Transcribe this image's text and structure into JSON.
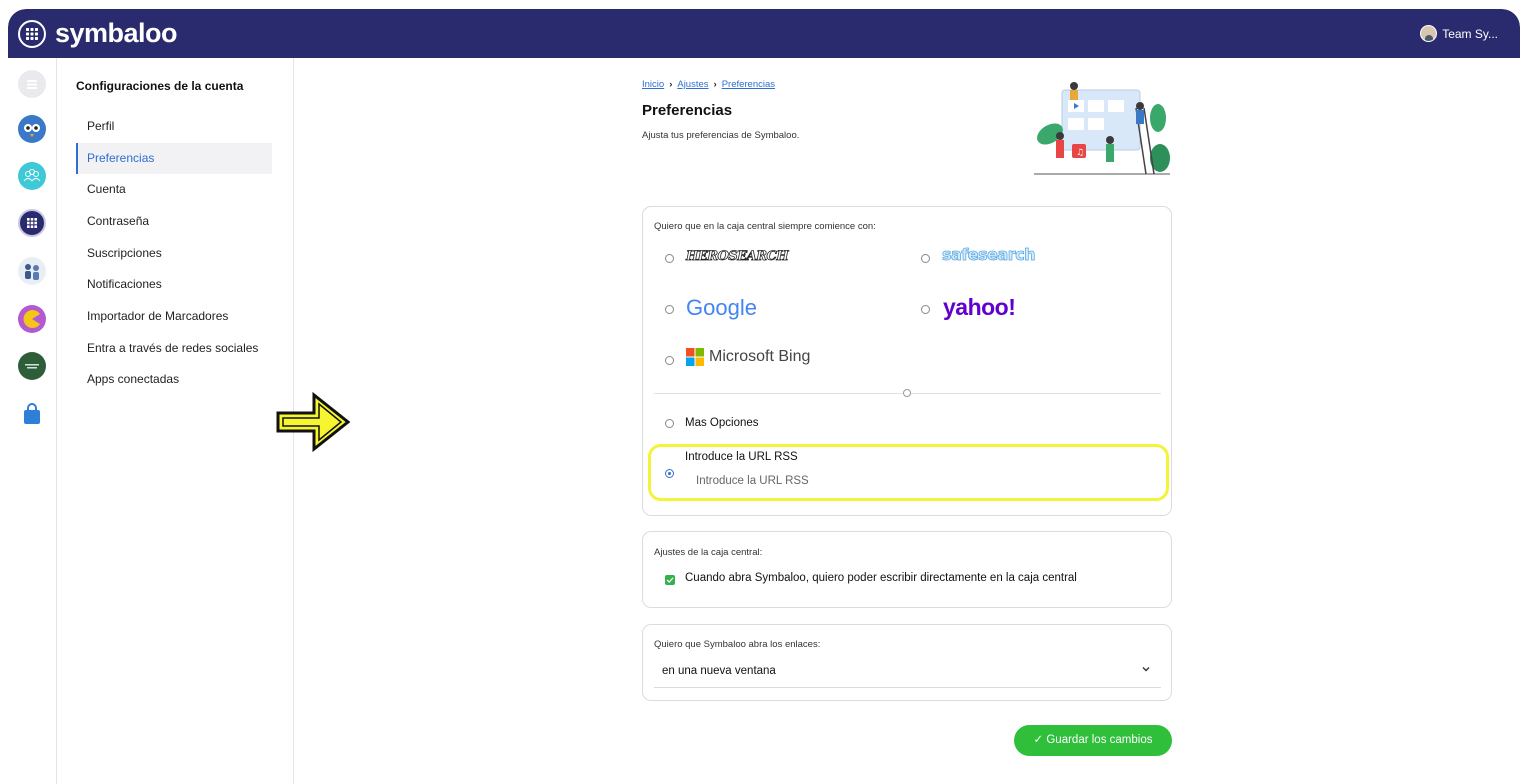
{
  "app": {
    "logo": "symbaloo",
    "team_label": "Team Sy..."
  },
  "sidebar": {
    "title": "Configuraciones de la cuenta",
    "items": [
      {
        "label": "Perfil"
      },
      {
        "label": "Preferencias",
        "active": true
      },
      {
        "label": "Cuenta"
      },
      {
        "label": "Contraseña"
      },
      {
        "label": "Suscripciones"
      },
      {
        "label": "Notificaciones"
      },
      {
        "label": "Importador de Marcadores"
      },
      {
        "label": "Entra a través de redes sociales"
      },
      {
        "label": "Apps conectadas"
      }
    ]
  },
  "breadcrumb": {
    "home": "Inicio",
    "settings": "Ajustes",
    "current": "Preferencias"
  },
  "page": {
    "title": "Preferencias",
    "subtitle": "Ajusta tus preferencias de Symbaloo."
  },
  "search_card": {
    "label": "Quiero que en la caja central siempre comience con:",
    "engines": {
      "herosearch": "HEROSEARCH",
      "safesearch": "safesearch",
      "google": "Google",
      "yahoo": "yahoo!",
      "bing": "Microsoft Bing"
    },
    "more_options": "Mas Opciones",
    "rss_option": "Introduce la URL RSS",
    "rss_placeholder": "Introduce la URL RSS"
  },
  "centralbox_card": {
    "label": "Ajustes de la caja central:",
    "checkbox_label": "Cuando abra Symbaloo, quiero poder escribir directamente en la caja central",
    "checked": true
  },
  "links_card": {
    "label": "Quiero que Symbaloo abra los enlaces:",
    "selected": "en una nueva ventana"
  },
  "save_button": "Guardar los cambios",
  "colors": {
    "topbar": "#2a2a6e",
    "accent": "#2f6fd0",
    "save": "#2fbf3a",
    "highlight": "#f3f339"
  }
}
